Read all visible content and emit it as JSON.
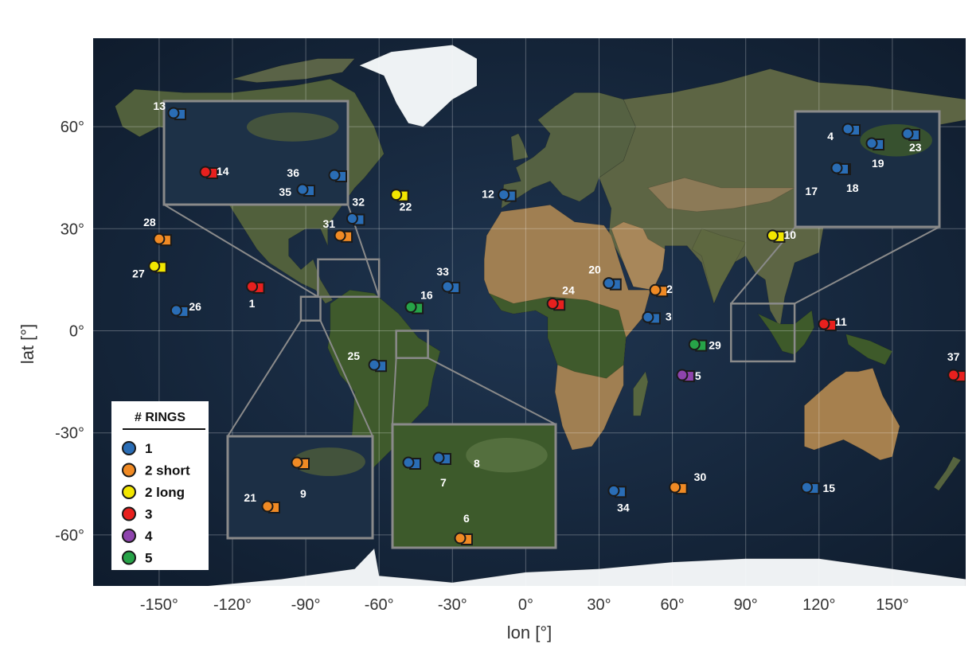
{
  "map": {
    "xlabel": "lon [°]",
    "ylabel": "lat [°]",
    "xticks": [
      {
        "value": -150,
        "label": "-150°"
      },
      {
        "value": -120,
        "label": "-120°"
      },
      {
        "value": -90,
        "label": "-90°"
      },
      {
        "value": -60,
        "label": "-60°"
      },
      {
        "value": -30,
        "label": "-30°"
      },
      {
        "value": 0,
        "label": "0°"
      },
      {
        "value": 30,
        "label": "30°"
      },
      {
        "value": 60,
        "label": "60°"
      },
      {
        "value": 90,
        "label": "90°"
      },
      {
        "value": 120,
        "label": "120°"
      },
      {
        "value": 150,
        "label": "150°"
      }
    ],
    "yticks": [
      {
        "value": 60,
        "label": "60°"
      },
      {
        "value": 30,
        "label": "30°"
      },
      {
        "value": 0,
        "label": "0°"
      },
      {
        "value": -30,
        "label": "-30°"
      },
      {
        "value": -60,
        "label": "-60°"
      }
    ],
    "lon_range": [
      -177,
      180
    ],
    "lat_range": [
      -75,
      86
    ],
    "grid": true,
    "background": "satellite imagery"
  },
  "legend": {
    "title": "# RINGS",
    "placement": "bottom-left",
    "items": [
      {
        "label": "1",
        "color": "#2a6db5"
      },
      {
        "label": "2 short",
        "color": "#f08a24"
      },
      {
        "label": "2 long",
        "color": "#f2e600"
      },
      {
        "label": "3",
        "color": "#e8201e"
      },
      {
        "label": "4",
        "color": "#8e44ad"
      },
      {
        "label": "5",
        "color": "#27a348"
      }
    ]
  },
  "colors": {
    "1": "#2a6db5",
    "2s": "#f08a24",
    "2l": "#f2e600",
    "3": "#e8201e",
    "4": "#8e44ad",
    "5": "#27a348"
  },
  "sites": [
    {
      "id": "1",
      "lon": -112,
      "lat": 13,
      "rings": "3"
    },
    {
      "id": "2",
      "lon": 53,
      "lat": 12,
      "rings": "2s"
    },
    {
      "id": "3",
      "lon": 50,
      "lat": 4,
      "rings": "1"
    },
    {
      "id": "5",
      "lon": 64,
      "lat": -13,
      "rings": "4"
    },
    {
      "id": "10",
      "lon": 101,
      "lat": 28,
      "rings": "2l"
    },
    {
      "id": "11",
      "lon": 122,
      "lat": 2,
      "rings": "3"
    },
    {
      "id": "12",
      "lon": -9,
      "lat": 40,
      "rings": "1"
    },
    {
      "id": "15",
      "lon": 115,
      "lat": -46,
      "rings": "1"
    },
    {
      "id": "16",
      "lon": -47,
      "lat": 7,
      "rings": "5"
    },
    {
      "id": "20",
      "lon": 34,
      "lat": 14,
      "rings": "1"
    },
    {
      "id": "22",
      "lon": -53,
      "lat": 40,
      "rings": "2l"
    },
    {
      "id": "24",
      "lon": 11,
      "lat": 8,
      "rings": "3"
    },
    {
      "id": "25",
      "lon": -62,
      "lat": -10,
      "rings": "1"
    },
    {
      "id": "26",
      "lon": -143,
      "lat": 6,
      "rings": "1"
    },
    {
      "id": "27",
      "lon": -152,
      "lat": 19,
      "rings": "2l"
    },
    {
      "id": "28",
      "lon": -150,
      "lat": 27,
      "rings": "2s"
    },
    {
      "id": "29",
      "lon": 69,
      "lat": -4,
      "rings": "5"
    },
    {
      "id": "30",
      "lon": 61,
      "lat": -46,
      "rings": "2s"
    },
    {
      "id": "31",
      "lon": -76,
      "lat": 28,
      "rings": "2s"
    },
    {
      "id": "32",
      "lon": -71,
      "lat": 33,
      "rings": "1"
    },
    {
      "id": "33",
      "lon": -32,
      "lat": 13,
      "rings": "1"
    },
    {
      "id": "34",
      "lon": 36,
      "lat": -47,
      "rings": "1"
    },
    {
      "id": "37",
      "lon": 175,
      "lat": -13,
      "rings": "3"
    }
  ],
  "insets": [
    {
      "name": "caribbean",
      "source_lon": [
        -85,
        -60
      ],
      "source_lat": [
        10,
        21
      ],
      "sites": [
        {
          "id": "13",
          "rings": "1"
        },
        {
          "id": "14",
          "rings": "3"
        },
        {
          "id": "35",
          "rings": "1"
        },
        {
          "id": "36",
          "rings": "1"
        }
      ]
    },
    {
      "name": "central-america",
      "source_lon": [
        -92,
        -84
      ],
      "source_lat": [
        3,
        10
      ],
      "sites": [
        {
          "id": "9",
          "rings": "2s"
        },
        {
          "id": "21",
          "rings": "2s"
        }
      ]
    },
    {
      "name": "amazon",
      "source_lon": [
        -53,
        -40
      ],
      "source_lat": [
        -8,
        0
      ],
      "sites": [
        {
          "id": "6",
          "rings": "2s"
        },
        {
          "id": "7",
          "rings": "1"
        },
        {
          "id": "8",
          "rings": "1"
        }
      ]
    },
    {
      "name": "indonesia",
      "source_lon": [
        84,
        110
      ],
      "source_lat": [
        -9,
        8
      ],
      "sites": [
        {
          "id": "4",
          "rings": "1"
        },
        {
          "id": "17",
          "rings": "1"
        },
        {
          "id": "18",
          "rings": "1"
        },
        {
          "id": "19",
          "rings": "1"
        },
        {
          "id": "23",
          "rings": "1"
        }
      ]
    }
  ]
}
